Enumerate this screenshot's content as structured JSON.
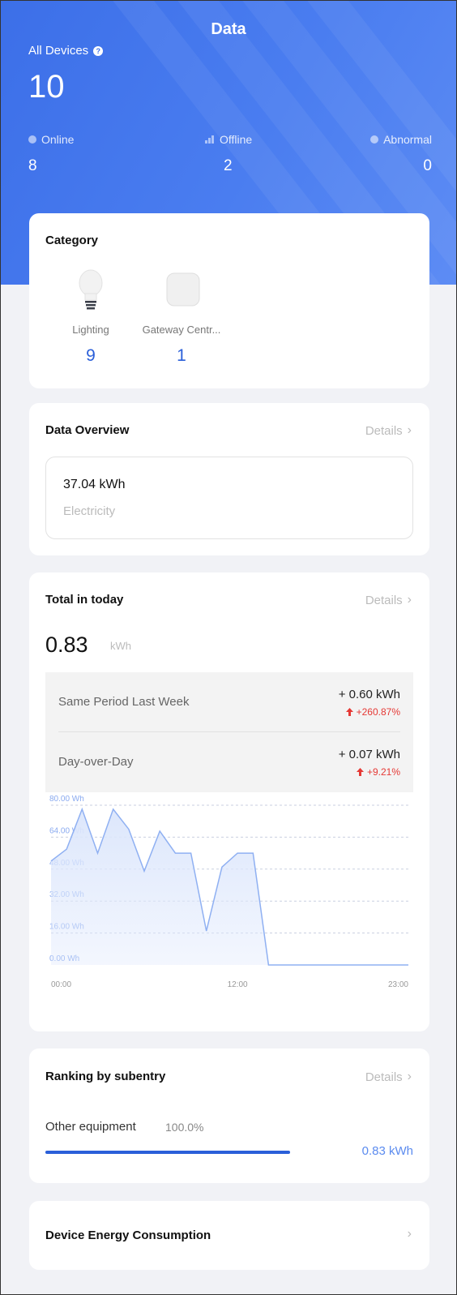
{
  "header": {
    "title": "Data",
    "all_devices_label": "All Devices",
    "all_devices_count": "10",
    "online_label": "Online",
    "online_count": "8",
    "offline_label": "Offline",
    "offline_count": "2",
    "abnormal_label": "Abnormal",
    "abnormal_count": "0"
  },
  "category": {
    "title": "Category",
    "items": [
      {
        "label": "Lighting",
        "count": "9",
        "icon": "lightbulb-icon"
      },
      {
        "label": "Gateway Centr...",
        "count": "1",
        "icon": "gateway-icon"
      }
    ]
  },
  "overview": {
    "title": "Data Overview",
    "details": "Details",
    "value": "37.04 kWh",
    "label": "Electricity"
  },
  "today": {
    "title": "Total in today",
    "details": "Details",
    "value": "0.83",
    "unit": "kWh",
    "comparisons": [
      {
        "label": "Same Period Last Week",
        "value": "+ 0.60 kWh",
        "change": "+260.87%"
      },
      {
        "label": "Day-over-Day",
        "value": "+ 0.07 kWh",
        "change": "+9.21%"
      }
    ]
  },
  "chart_data": {
    "type": "area",
    "x_ticks": [
      "00:00",
      "12:00",
      "23:00"
    ],
    "y_ticks": [
      "80.00 Wh",
      "64.00 Wh",
      "48.00 Wh",
      "32.00 Wh",
      "16.00 Wh",
      "0.00 Wh"
    ],
    "ylim": [
      0,
      80
    ],
    "x_range": [
      0,
      23
    ],
    "x": [
      0,
      1,
      2,
      3,
      4,
      5,
      6,
      7,
      8,
      9,
      10,
      11,
      12,
      13,
      14,
      15,
      16,
      17,
      18,
      19,
      20,
      21,
      22,
      23
    ],
    "values": [
      52,
      58,
      78,
      56,
      78,
      68,
      47,
      67,
      56,
      56,
      17,
      49,
      56,
      56,
      0,
      0,
      0,
      0,
      0,
      0,
      0,
      0,
      0,
      0
    ],
    "colors": {
      "line": "#8fb0f2",
      "fill": "#dde7fc"
    }
  },
  "ranking": {
    "title": "Ranking by subentry",
    "details": "Details",
    "item_label": "Other equipment",
    "item_percent": "100.0%",
    "item_value": "0.83 kWh",
    "bar_fraction": 1.0
  },
  "device_energy": {
    "title": "Device Energy Consumption"
  },
  "colors": {
    "accent": "#2a5fd9",
    "header": "#3c6fe8",
    "increase": "#e53935"
  }
}
